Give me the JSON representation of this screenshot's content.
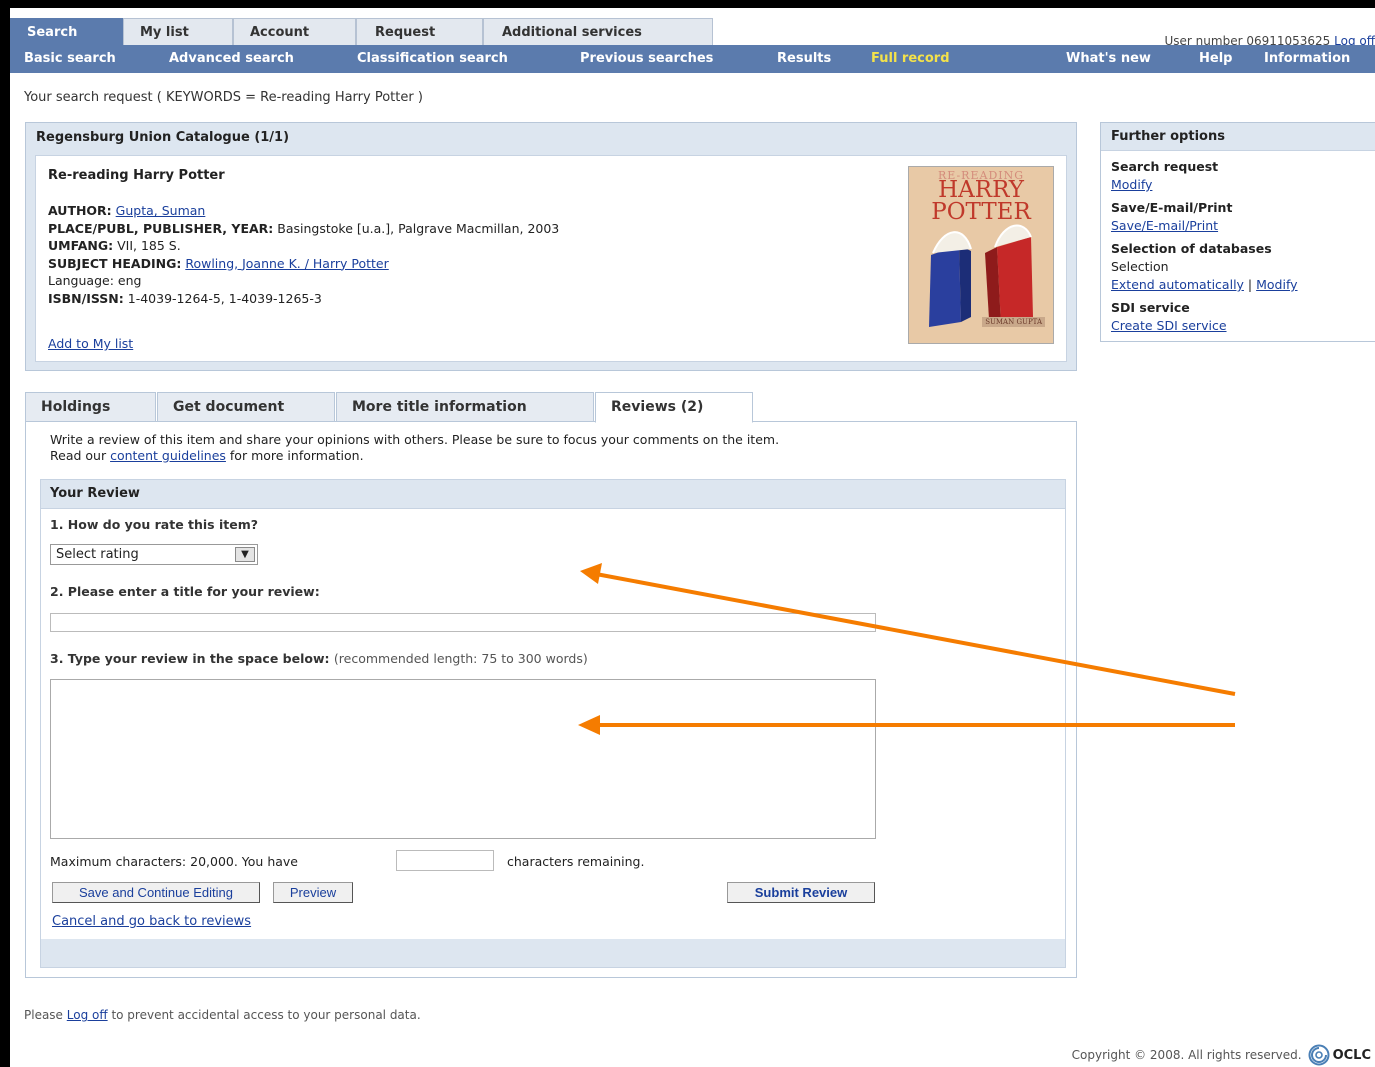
{
  "top_tabs": [
    "Search",
    "My list",
    "Account",
    "Request",
    "Additional services"
  ],
  "user": {
    "label": "User number 06911053625",
    "logoff": "Log off"
  },
  "nav_items": [
    "Basic search",
    "Advanced search",
    "Classification search",
    "Previous searches",
    "Results",
    "Full record"
  ],
  "nav_right": [
    "What's new",
    "Help",
    "Information"
  ],
  "search_request": "Your search request ( KEYWORDS  =  Re-reading  Harry  Potter )",
  "catalogue": {
    "header": "Regensburg Union Catalogue (1/1)",
    "title": "Re-reading Harry Potter",
    "author_label": "AUTHOR:",
    "author": "Gupta, Suman",
    "place_label": "PLACE/PUBL, PUBLISHER, YEAR:",
    "place": "Basingstoke [u.a.], Palgrave Macmillan, 2003",
    "umfang_label": "UMFANG:",
    "umfang": "VII, 185 S.",
    "subject_label": "SUBJECT HEADING:",
    "subject": "Rowling, Joanne K. / Harry Potter",
    "language_label": "Language:",
    "language": "eng",
    "isbn_label": "ISBN/ISSN:",
    "isbn": "1-4039-1264-5, 1-4039-1265-3",
    "add_to_list": "Add to My list",
    "cover": {
      "line1": "RE-READING",
      "line2": "HARRY",
      "line3": "POTTER",
      "author": "SUMAN GUPTA"
    }
  },
  "further_options": {
    "header": "Further options",
    "search_request": "Search request",
    "modify": "Modify",
    "save_label": "Save/E-mail/Print",
    "save_link": "Save/E-mail/Print",
    "selection_db": "Selection of databases",
    "selection": "Selection",
    "extend": "Extend automatically",
    "sep": "|",
    "modify2": "Modify",
    "sdi": "SDI service",
    "create_sdi": "Create SDI service"
  },
  "lower_tabs": [
    "Holdings",
    "Get document",
    "More title information",
    "Reviews (2)"
  ],
  "review": {
    "intro1": "Write a review of this item and share your opinions with others. Please be sure to focus your comments on the item.",
    "intro2_pre": "Read our ",
    "intro2_link": "content guidelines",
    "intro2_post": " for more information.",
    "header": "Your Review",
    "q1": "1. How do you rate this item?",
    "rating_value": "Select rating",
    "q2": "2. Please enter a title for your review:",
    "q3": "3. Type your review in the space below:",
    "q3_note": "(recommended length: 75 to 300 words)",
    "max_chars": "Maximum characters: 20,000. You have",
    "remaining": "characters remaining.",
    "save_btn": "Save and Continue Editing",
    "preview_btn": "Preview",
    "submit_btn": "Submit Review",
    "cancel": "Cancel and go back to reviews"
  },
  "footer": {
    "pre": "Please ",
    "logoff": "Log off",
    "post": " to prevent accidental access to your personal data.",
    "copyright": "Copyright © 2008. All rights reserved.",
    "logo": "OCLC"
  },
  "colors": {
    "nav_bg": "#5b7bad",
    "highlight": "#f4e24a",
    "arrow": "#f57c00",
    "panel_bg": "#dde6f0"
  }
}
